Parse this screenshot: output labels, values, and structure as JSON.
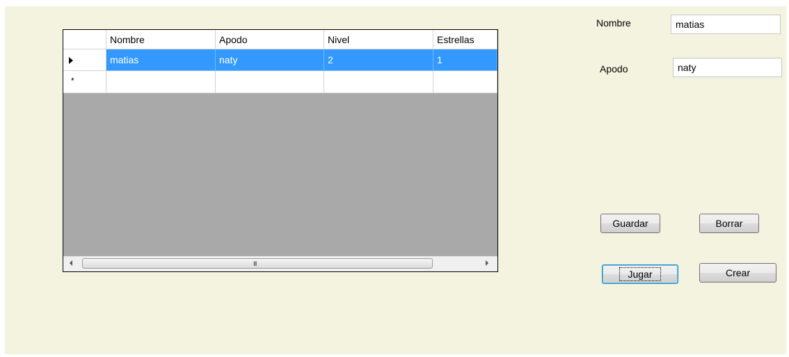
{
  "grid": {
    "columns": [
      "Nombre",
      "Apodo",
      "Nivel",
      "Estrellas"
    ],
    "rows": [
      {
        "nombre": "matias",
        "apodo": "naty",
        "nivel": "2",
        "estrellas": "1",
        "selected": true
      }
    ],
    "new_row_marker": "*",
    "scroll_grip": "III"
  },
  "form": {
    "nombre_label": "Nombre",
    "nombre_value": "matias",
    "apodo_label": "Apodo",
    "apodo_value": "naty"
  },
  "buttons": {
    "guardar": "Guardar",
    "borrar": "Borrar",
    "jugar": "Jugar",
    "crear": "Crear"
  },
  "colors": {
    "form_background": "#f4f3df",
    "selection": "#3399ff",
    "grid_background": "#a9a9a9"
  }
}
